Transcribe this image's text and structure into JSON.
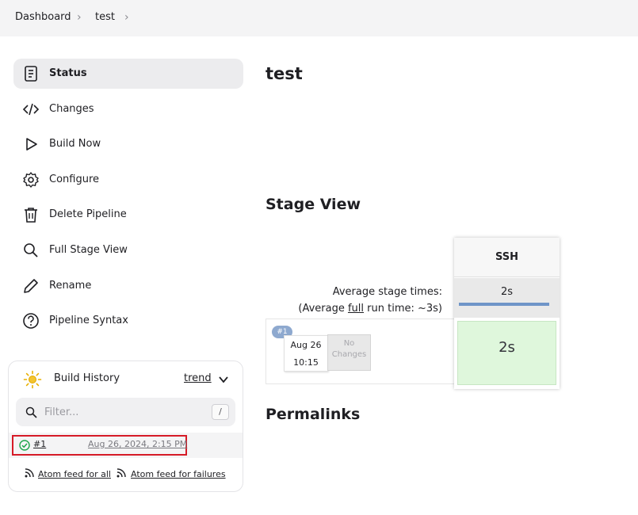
{
  "breadcrumb": {
    "items": [
      "Dashboard",
      "test"
    ]
  },
  "sidebar": {
    "items": [
      {
        "label": "Status",
        "icon": "status-doc-icon",
        "active": true
      },
      {
        "label": "Changes",
        "icon": "code-icon"
      },
      {
        "label": "Build Now",
        "icon": "play-icon"
      },
      {
        "label": "Configure",
        "icon": "gear-icon"
      },
      {
        "label": "Delete Pipeline",
        "icon": "trash-icon"
      },
      {
        "label": "Full Stage View",
        "icon": "search-icon"
      },
      {
        "label": "Rename",
        "icon": "pencil-icon"
      },
      {
        "label": "Pipeline Syntax",
        "icon": "help-icon"
      }
    ]
  },
  "build_history": {
    "title": "Build History",
    "trend": "trend",
    "filter_placeholder": "Filter...",
    "shortcut": "/",
    "builds": [
      {
        "number": "#1",
        "date": "Aug 26, 2024, 2:15 PM",
        "status": "success"
      }
    ],
    "feeds": {
      "all": "Atom feed for all",
      "failures": "Atom feed for failures"
    }
  },
  "main": {
    "title": "test",
    "stage_view_heading": "Stage View",
    "permalinks_heading": "Permalinks"
  },
  "stage_view": {
    "avg_stage_times_label": "Average stage times:",
    "avg_full_prefix": "(Average ",
    "avg_full_link": "full",
    "avg_full_suffix": " run time: ~3s)",
    "stages": [
      {
        "name": "SSH",
        "avg_time": "2s"
      }
    ],
    "runs": [
      {
        "badge": "#1",
        "date": "Aug 26",
        "time": "10:15",
        "changes": "No Changes",
        "durations": [
          "2s"
        ]
      }
    ]
  },
  "colors": {
    "success_cell": "#dff7dc",
    "selection_outline": "#d61b27",
    "avg_bar": "#6f95c8"
  }
}
